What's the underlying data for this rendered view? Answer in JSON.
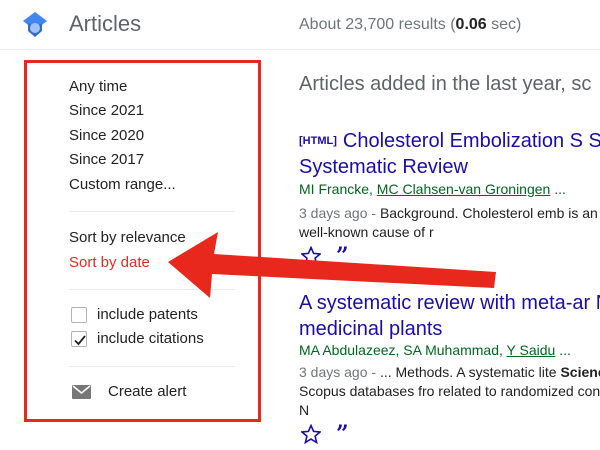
{
  "header": {
    "title": "Articles",
    "results_prefix": "About 23,700 results (",
    "results_time": "0.06",
    "results_suffix": " sec)"
  },
  "sidebar": {
    "time_filters": [
      "Any time",
      "Since 2021",
      "Since 2020",
      "Since 2017",
      "Custom range..."
    ],
    "sort_relevance": "Sort by relevance",
    "sort_date": "Sort by date",
    "include_patents": {
      "label": "include patents",
      "checked": false
    },
    "include_citations": {
      "label": "include citations",
      "checked": true
    },
    "create_alert": "Create alert"
  },
  "main": {
    "section_heading": "Articles added in the last year, sc",
    "results": [
      {
        "tag": "[HTML]",
        "title": "Cholesterol Embolization S Series and Systematic Review",
        "authors_plain": "MI Francke, ",
        "authors_link": "MC Clahsen-van Groningen",
        "authors_tail": " ...",
        "date": "3 days ago - ",
        "snippet": "Background. Cholesterol emb is an uncommon but well-known cause of r"
      },
      {
        "tag": "",
        "title": "A systematic review with meta-ar Nigerian medicinal plants",
        "authors_plain": "MA Abdulazeez, SA Muhammad, ",
        "authors_link": "Y Saidu",
        "authors_tail": " ...",
        "date": "3 days ago - ",
        "snippet_pre": "... Methods. A systematic lite ",
        "snippet_bold": "Science Direct",
        "snippet_post": " and Scopus databases fro related to randomized controlled trials of N"
      }
    ]
  },
  "colors": {
    "accent_red": "#e8281c",
    "link_blue": "#1a0dab",
    "author_green": "#006621",
    "active_red": "#d93025"
  },
  "icons": [
    "scholar-logo-icon",
    "checkbox-checked-icon",
    "mail-icon",
    "star-icon",
    "cite-quote-icon",
    "annotation-arrow"
  ]
}
